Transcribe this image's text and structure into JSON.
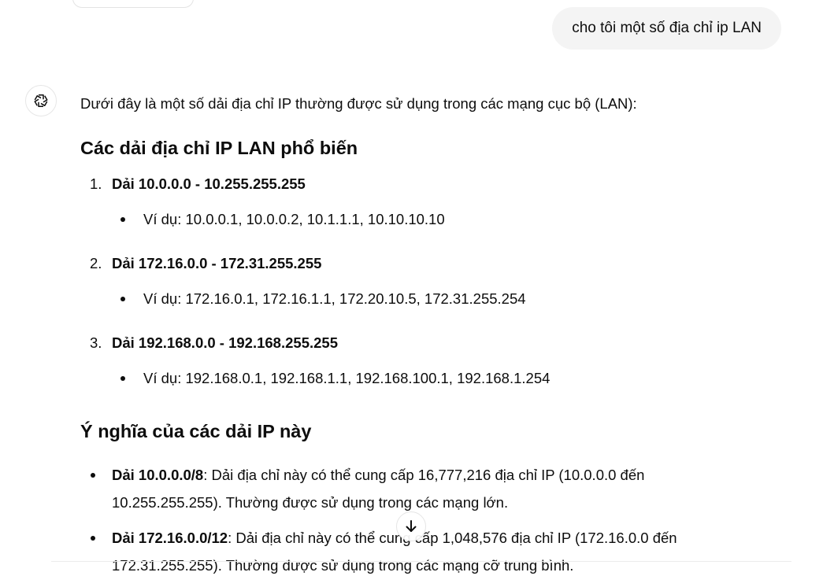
{
  "user_message": "cho tôi một số địa chỉ ip LAN",
  "assistant": {
    "intro": "Dưới đây là một số dải địa chỉ IP thường được sử dụng trong các mạng cục bộ (LAN):",
    "section1_title": "Các dải địa chỉ IP LAN phổ biến",
    "ranges": [
      {
        "number": "1.",
        "title": "Dải 10.0.0.0 - 10.255.255.255",
        "example": "Ví dụ: 10.0.0.1, 10.0.0.2, 10.1.1.1, 10.10.10.10"
      },
      {
        "number": "2.",
        "title": "Dải 172.16.0.0 - 172.31.255.255",
        "example": "Ví dụ: 172.16.0.1, 172.16.1.1, 172.20.10.5, 172.31.255.254"
      },
      {
        "number": "3.",
        "title": "Dải 192.168.0.0 - 192.168.255.255",
        "example": "Ví dụ: 192.168.0.1, 192.168.1.1, 192.168.100.1, 192.168.1.254"
      }
    ],
    "section2_title": "Ý nghĩa của các dải IP này",
    "meanings": [
      {
        "label": "Dải 10.0.0.0/8",
        "text": ": Dải địa chỉ này có thể cung cấp 16,777,216 địa chỉ IP (10.0.0.0 đến 10.255.255.255). Thường được sử dụng trong các mạng lớn."
      },
      {
        "label": "Dải 172.16.0.0/12",
        "text": ": Dải địa chỉ này có thể cung cấp 1,048,576 địa chỉ IP (172.16.0.0 đến 172.31.255.255). Thường được sử dụng trong các mạng cỡ trung bình."
      }
    ]
  },
  "icons": {
    "avatar": "openai-logo-icon",
    "scroll": "arrow-down-icon"
  }
}
